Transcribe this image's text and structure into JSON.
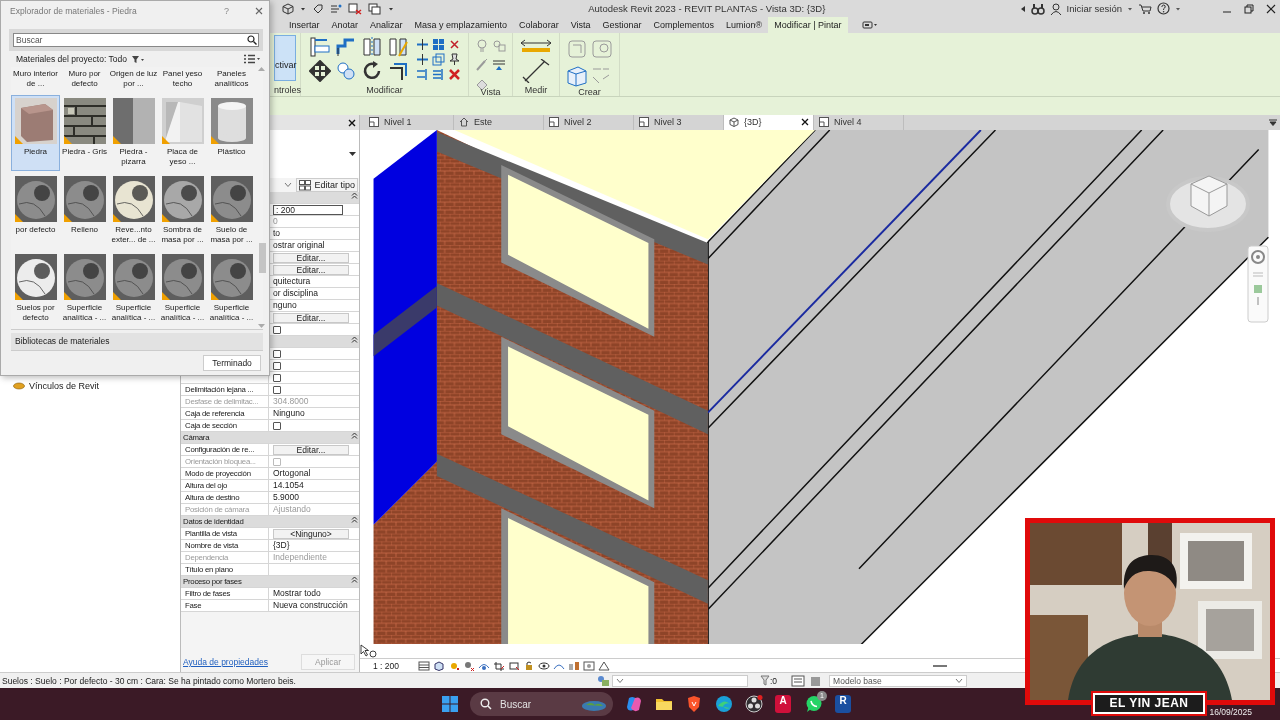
{
  "title_bar": {
    "title": "Autodesk Revit 2023 - REVIT PLANTAS - Vista 3D: {3D}",
    "sign_in": "Iniciar sesión"
  },
  "ribbon": {
    "tabs": [
      {
        "label": "Insertar",
        "selected": false
      },
      {
        "label": "Anotar",
        "selected": false
      },
      {
        "label": "Analizar",
        "selected": false
      },
      {
        "label": "Masa y emplazamiento",
        "selected": false
      },
      {
        "label": "Colaborar",
        "selected": false
      },
      {
        "label": "Vista",
        "selected": false
      },
      {
        "label": "Gestionar",
        "selected": false
      },
      {
        "label": "Complementos",
        "selected": false
      },
      {
        "label": "Lumion®",
        "selected": false
      },
      {
        "label": "Modificar | Pintar",
        "selected": true
      }
    ],
    "panels": [
      {
        "kind": "controls",
        "label": "ntroles",
        "button": "ctivar"
      },
      {
        "kind": "modify",
        "label": "Modificar"
      },
      {
        "kind": "view",
        "label": "Vista"
      },
      {
        "kind": "measure",
        "label": "Medir"
      },
      {
        "kind": "create",
        "label": "Crear"
      }
    ]
  },
  "material_browser": {
    "title": "Explorador de materiales - Piedra",
    "help": "?",
    "search": {
      "placeholder": "Buscar"
    },
    "filter_label": "Materiales del proyecto: Todo",
    "header_labels": [
      "Muro interior de ...",
      "Muro por defecto",
      "Origen de luz por ...",
      "Panel yeso techo",
      "Paneles analíticos"
    ],
    "materials": [
      {
        "name": "Piedra",
        "kind": "cube",
        "selected": true
      },
      {
        "name": "Piedra - Gris",
        "kind": "stone",
        "selected": false
      },
      {
        "name": "Piedra - pizarra",
        "kind": "slate",
        "selected": false
      },
      {
        "name": "Placa de yeso ...",
        "kind": "plaster",
        "selected": false
      },
      {
        "name": "Plástico",
        "kind": "cylinder",
        "selected": false
      },
      {
        "name": "por defecto",
        "kind": "sphere",
        "selected": false
      },
      {
        "name": "Relleno",
        "kind": "sphere",
        "selected": false
      },
      {
        "name": "Reve...nto exter... de ...",
        "kind": "sphere-cream",
        "selected": false
      },
      {
        "name": "Sombra de masa por ...",
        "kind": "sphere-glass",
        "selected": false
      },
      {
        "name": "Suelo de masa por ...",
        "kind": "sphere",
        "selected": false
      },
      {
        "name": "Suelos por defecto",
        "kind": "sphere-white",
        "selected": false
      },
      {
        "name": "Superficie analítica - ...",
        "kind": "sphere",
        "selected": false
      },
      {
        "name": "Superficie analítica - ...",
        "kind": "sphere",
        "selected": false
      },
      {
        "name": "Superficie analítica - ...",
        "kind": "sphere",
        "selected": false
      },
      {
        "name": "Superficie analítica - ...",
        "kind": "sphere",
        "selected": false
      }
    ],
    "libraries": "Bibliotecas de materiales",
    "done_button": "Terminado"
  },
  "project_browser": {
    "items": [
      {
        "label": "Vínculos de Revit"
      }
    ]
  },
  "properties": {
    "edit_type": "Editar tipo",
    "rows": [
      {
        "kind": "header"
      },
      {
        "kind": "input",
        "value": ": 200",
        "disabled": false
      },
      {
        "kind": "text",
        "value": "0",
        "disabled": true
      },
      {
        "kind": "text",
        "value": "to",
        "disabled": false
      },
      {
        "kind": "text",
        "value": "ostrar original",
        "disabled": false
      },
      {
        "kind": "button",
        "value": "Editar...",
        "disabled": false
      },
      {
        "kind": "button",
        "value": "Editar...",
        "disabled": false
      },
      {
        "kind": "text",
        "value": "quitectura",
        "disabled": false
      },
      {
        "kind": "text",
        "value": "or disciplina",
        "disabled": false
      },
      {
        "kind": "text",
        "value": "nguno",
        "disabled": false
      },
      {
        "kind": "button",
        "value": "Editar...",
        "disabled": false
      },
      {
        "kind": "checkbox",
        "checked": false,
        "disabled": false
      },
      {
        "kind": "header"
      },
      {
        "kind": "checkbox",
        "checked": false,
        "disabled": false
      },
      {
        "kind": "checkbox",
        "checked": false,
        "disabled": false
      },
      {
        "kind": "checkbox",
        "checked": false,
        "disabled": false
      },
      {
        "kind": "checkbox",
        "label": "Delimitación lejana ...",
        "checked": false,
        "disabled": false
      },
      {
        "kind": "text",
        "label": "Desfase de delimitac...",
        "value": "304.8000",
        "disabled": true
      },
      {
        "kind": "text",
        "label": "Caja de referencia",
        "value": "Ninguno",
        "disabled": false
      },
      {
        "kind": "checkbox",
        "label": "Caja de sección",
        "checked": false,
        "disabled": false
      },
      {
        "kind": "header",
        "label": "Cámara"
      },
      {
        "kind": "button",
        "label": "Configuración de re...",
        "value": "Editar...",
        "disabled": false
      },
      {
        "kind": "checkbox",
        "label": "Orientación bloquea...",
        "checked": false,
        "disabled": true
      },
      {
        "kind": "text",
        "label": "Modo de proyección",
        "value": "Ortogonal",
        "disabled": false
      },
      {
        "kind": "text",
        "label": "Altura del ojo",
        "value": "14.1054",
        "disabled": false
      },
      {
        "kind": "text",
        "label": "Altura de destino",
        "value": "5.9000",
        "disabled": false
      },
      {
        "kind": "text",
        "label": "Posición de cámara",
        "value": "Ajustando",
        "disabled": true
      },
      {
        "kind": "header",
        "label": "Datos de identidad"
      },
      {
        "kind": "button",
        "label": "Plantilla de vista",
        "value": "<Ninguno>",
        "disabled": false
      },
      {
        "kind": "text",
        "label": "Nombre de vista",
        "value": "{3D}",
        "disabled": false
      },
      {
        "kind": "text",
        "label": "Dependencia",
        "value": "Independiente",
        "disabled": true
      },
      {
        "kind": "text",
        "label": "Título en plano",
        "disabled": false
      },
      {
        "kind": "header",
        "label": "Proceso por fases"
      },
      {
        "kind": "text",
        "label": "Filtro de fases",
        "value": "Mostrar todo",
        "disabled": false
      },
      {
        "kind": "text",
        "label": "Fase",
        "value": "Nueva construcción",
        "disabled": false
      }
    ],
    "help_link": "Ayuda de propiedades",
    "apply_button": "Aplicar"
  },
  "view_tabs": [
    {
      "label": "Nivel 1",
      "kind": "plan",
      "selected": false
    },
    {
      "label": "Este",
      "kind": "elevation",
      "selected": false
    },
    {
      "label": "Nivel 2",
      "kind": "plan",
      "selected": false
    },
    {
      "label": "Nivel 3",
      "kind": "plan",
      "selected": false
    },
    {
      "label": "{3D}",
      "kind": "model",
      "selected": true
    },
    {
      "label": "Nivel 4",
      "kind": "plan",
      "selected": false
    }
  ],
  "view_bar": {
    "scale": "1 : 200"
  },
  "status_bar": {
    "message": "Suelos : Suelo : Por defecto - 30 cm : Cara: Se ha pintado como Mortero beis.",
    "selection_count": ":0",
    "model": "Modelo base"
  },
  "taskbar": {
    "search": {
      "placeholder": "Buscar"
    },
    "apps": [
      {
        "kind": "copilot"
      },
      {
        "kind": "folder"
      },
      {
        "kind": "shield"
      },
      {
        "kind": "wave"
      },
      {
        "kind": "recorder"
      },
      {
        "kind": "letter",
        "glyph": "A"
      },
      {
        "kind": "chat",
        "badge": "1"
      },
      {
        "kind": "letter",
        "glyph": "R"
      }
    ],
    "date": "16/09/2025"
  },
  "webcam": {
    "kind": "picture",
    "caption": "EL YIN JEAN"
  }
}
